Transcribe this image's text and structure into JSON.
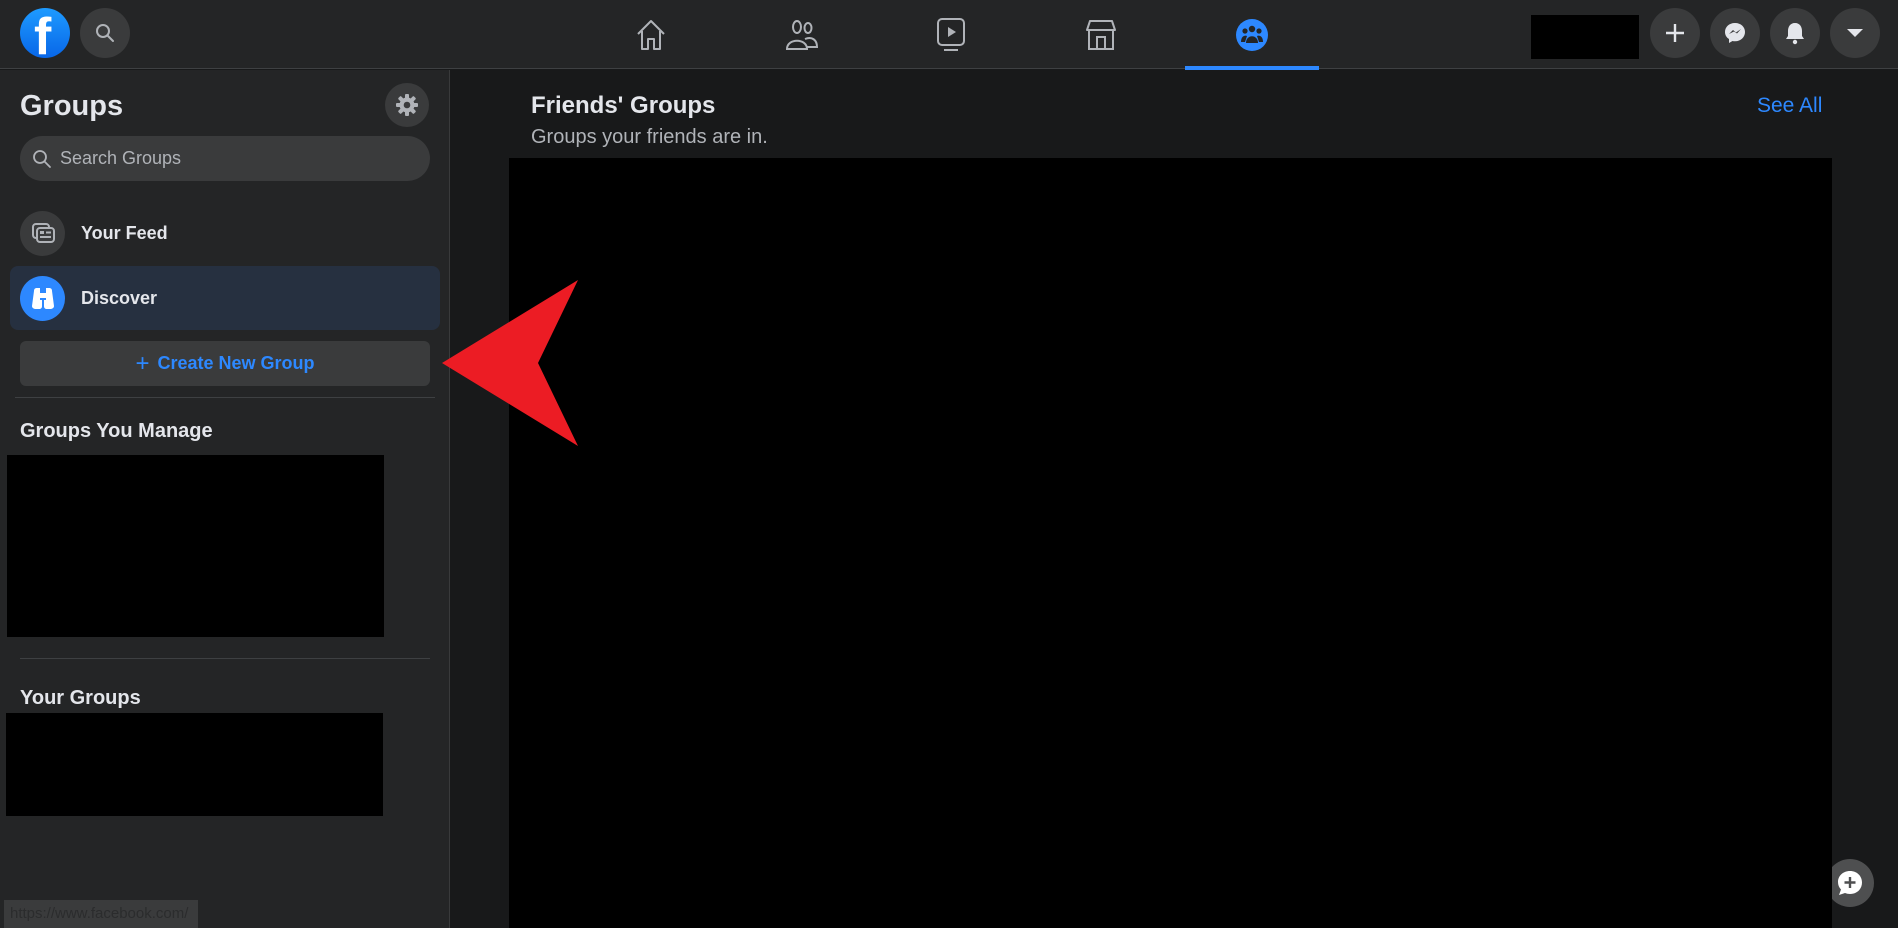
{
  "topbar": {
    "logo_letter": "f",
    "nav_tabs": [
      {
        "name": "home",
        "icon": "home-icon",
        "active": false
      },
      {
        "name": "friends",
        "icon": "friends-icon",
        "active": false
      },
      {
        "name": "watch",
        "icon": "watch-icon",
        "active": false
      },
      {
        "name": "marketplace",
        "icon": "marketplace-icon",
        "active": false
      },
      {
        "name": "groups",
        "icon": "groups-icon",
        "active": true
      }
    ],
    "right_buttons": [
      "create-icon",
      "messenger-icon",
      "notifications-icon",
      "account-menu-icon"
    ]
  },
  "sidebar": {
    "title": "Groups",
    "search_placeholder": "Search Groups",
    "items": [
      {
        "label": "Your Feed",
        "icon": "feed-icon",
        "active": false
      },
      {
        "label": "Discover",
        "icon": "binoculars-icon",
        "active": true
      }
    ],
    "create_button": {
      "plus": "+",
      "label": "Create New Group"
    },
    "sections": {
      "manage": "Groups You Manage",
      "yours": "Your Groups"
    }
  },
  "main": {
    "title": "Friends' Groups",
    "subtitle": "Groups your friends are in.",
    "see_all": "See All"
  },
  "status_url": "https://www.facebook.com/",
  "colors": {
    "accent": "#2d88ff",
    "surface": "#242526",
    "background": "#18191a",
    "annotation_arrow": "#ec1c24"
  }
}
